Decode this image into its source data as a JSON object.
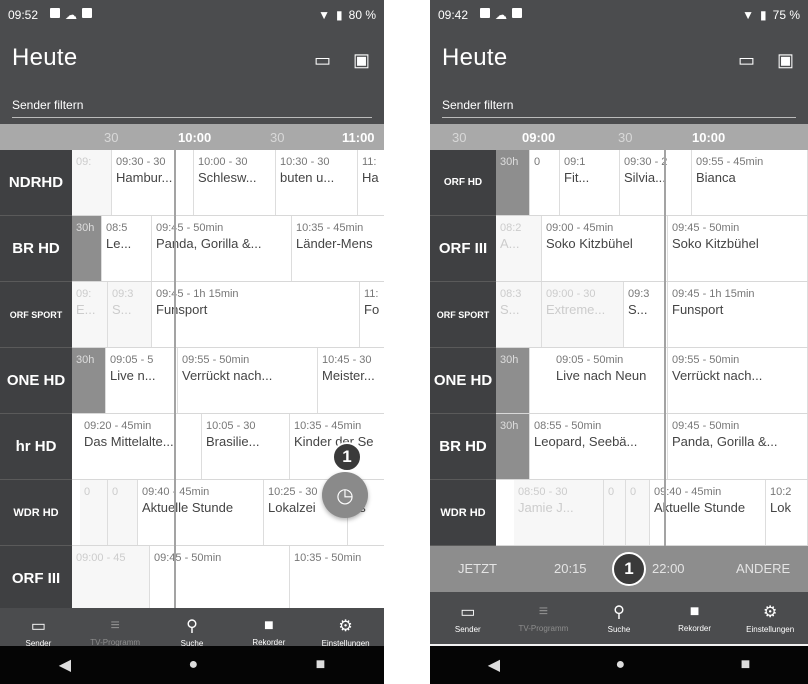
{
  "left": {
    "status": {
      "time": "09:52",
      "battery": "80 %"
    },
    "title": "Heute",
    "filter_label": "Sender filtern",
    "times": [
      "30",
      "10:00",
      "30",
      "11:00"
    ],
    "rows": [
      {
        "logo": "NDRHD",
        "progs": [
          {
            "t": "09:",
            "n": ""
          },
          {
            "t": "09:30 - 30",
            "n": "Hambur..."
          },
          {
            "t": "10:00 - 30",
            "n": "Schlesw..."
          },
          {
            "t": "10:30 - 30",
            "n": "buten u..."
          },
          {
            "t": "11:",
            "n": "Ha"
          }
        ]
      },
      {
        "logo": "BR HD",
        "progs": [
          {
            "t": "30h",
            "n": ""
          },
          {
            "t": "08:5",
            "n": "Le..."
          },
          {
            "t": "09:45 - 50min",
            "n": "Panda, Gorilla &..."
          },
          {
            "t": "10:35 - 45min",
            "n": "Länder-Mens"
          }
        ]
      },
      {
        "logo": "ORF SPORT",
        "progs": [
          {
            "t": "09:",
            "n": "E..."
          },
          {
            "t": "09:3",
            "n": "S..."
          },
          {
            "t": "09:45 - 1h 15min",
            "n": "Funsport"
          },
          {
            "t": "11:",
            "n": "Fo"
          }
        ]
      },
      {
        "logo": "ONE HD",
        "progs": [
          {
            "t": "30h",
            "n": ""
          },
          {
            "t": "09:05 - 5",
            "n": "Live n..."
          },
          {
            "t": "09:55 - 50min",
            "n": "Verrückt nach..."
          },
          {
            "t": "10:45 - 30",
            "n": "Meister..."
          }
        ]
      },
      {
        "logo": "hr HD",
        "progs": [
          {
            "t": "09:20 - 45min",
            "n": "Das Mittelalte..."
          },
          {
            "t": "10:05 - 30",
            "n": "Brasilie..."
          },
          {
            "t": "10:35 - 45min",
            "n": "Kinder der Se"
          }
        ]
      },
      {
        "logo": "WDR HD",
        "progs": [
          {
            "t": "0",
            "n": ""
          },
          {
            "t": "0",
            "n": ""
          },
          {
            "t": "09:40 - 45min",
            "n": "Aktuelle Stunde"
          },
          {
            "t": "10:25 - 30",
            "n": "Lokalzei"
          },
          {
            "t": ":55",
            "n": "as"
          }
        ]
      },
      {
        "logo": "ORF III",
        "progs": [
          {
            "t": "09:00 - 45",
            "n": ""
          },
          {
            "t": "09:45 - 50min",
            "n": ""
          },
          {
            "t": "10:35 - 50min",
            "n": ""
          }
        ]
      }
    ],
    "badge": "1"
  },
  "right": {
    "status": {
      "time": "09:42",
      "battery": "75 %"
    },
    "title": "Heute",
    "filter_label": "Sender filtern",
    "times": [
      "30",
      "09:00",
      "30",
      "10:00"
    ],
    "rows": [
      {
        "logo": "ORF HD",
        "progs": [
          {
            "t": "30h",
            "n": ""
          },
          {
            "t": "0",
            "n": ""
          },
          {
            "t": "09:1",
            "n": "Fit..."
          },
          {
            "t": "09:30 - 2",
            "n": "Silvia..."
          },
          {
            "t": "09:55 - 45min",
            "n": "Bianca"
          }
        ]
      },
      {
        "logo": "ORF III",
        "progs": [
          {
            "t": "08:2",
            "n": "A..."
          },
          {
            "t": "09:00 - 45min",
            "n": "Soko Kitzbühel"
          },
          {
            "t": "09:45 - 50min",
            "n": "Soko Kitzbühel"
          }
        ]
      },
      {
        "logo": "ORF SPORT",
        "progs": [
          {
            "t": "08:3",
            "n": "S..."
          },
          {
            "t": "09:00 - 30",
            "n": "Extreme..."
          },
          {
            "t": "09:3",
            "n": "S..."
          },
          {
            "t": "09:45 - 1h 15min",
            "n": "Funsport"
          }
        ]
      },
      {
        "logo": "ONE HD",
        "progs": [
          {
            "t": "30h",
            "n": ""
          },
          {
            "t": "09:05 - 50min",
            "n": "Live nach Neun"
          },
          {
            "t": "09:55 - 50min",
            "n": "Verrückt nach..."
          }
        ]
      },
      {
        "logo": "BR HD",
        "progs": [
          {
            "t": "30h",
            "n": ""
          },
          {
            "t": "08:55 - 50min",
            "n": "Leopard, Seebä..."
          },
          {
            "t": "09:45 - 50min",
            "n": "Panda, Gorilla &..."
          }
        ]
      },
      {
        "logo": "WDR HD",
        "progs": [
          {
            "t": "08:50 - 30",
            "n": "Jamie J..."
          },
          {
            "t": "0",
            "n": ""
          },
          {
            "t": "0",
            "n": ""
          },
          {
            "t": "09:40 - 45min",
            "n": "Aktuelle Stunde"
          },
          {
            "t": "10:2",
            "n": "Lok"
          }
        ]
      }
    ],
    "quick": [
      "JETZT",
      "20:15",
      "22:00",
      "ANDERE"
    ],
    "badge": "1"
  },
  "nav": [
    "Sender",
    "TV-Programm",
    "Suche",
    "Rekorder",
    "Einstellungen"
  ]
}
